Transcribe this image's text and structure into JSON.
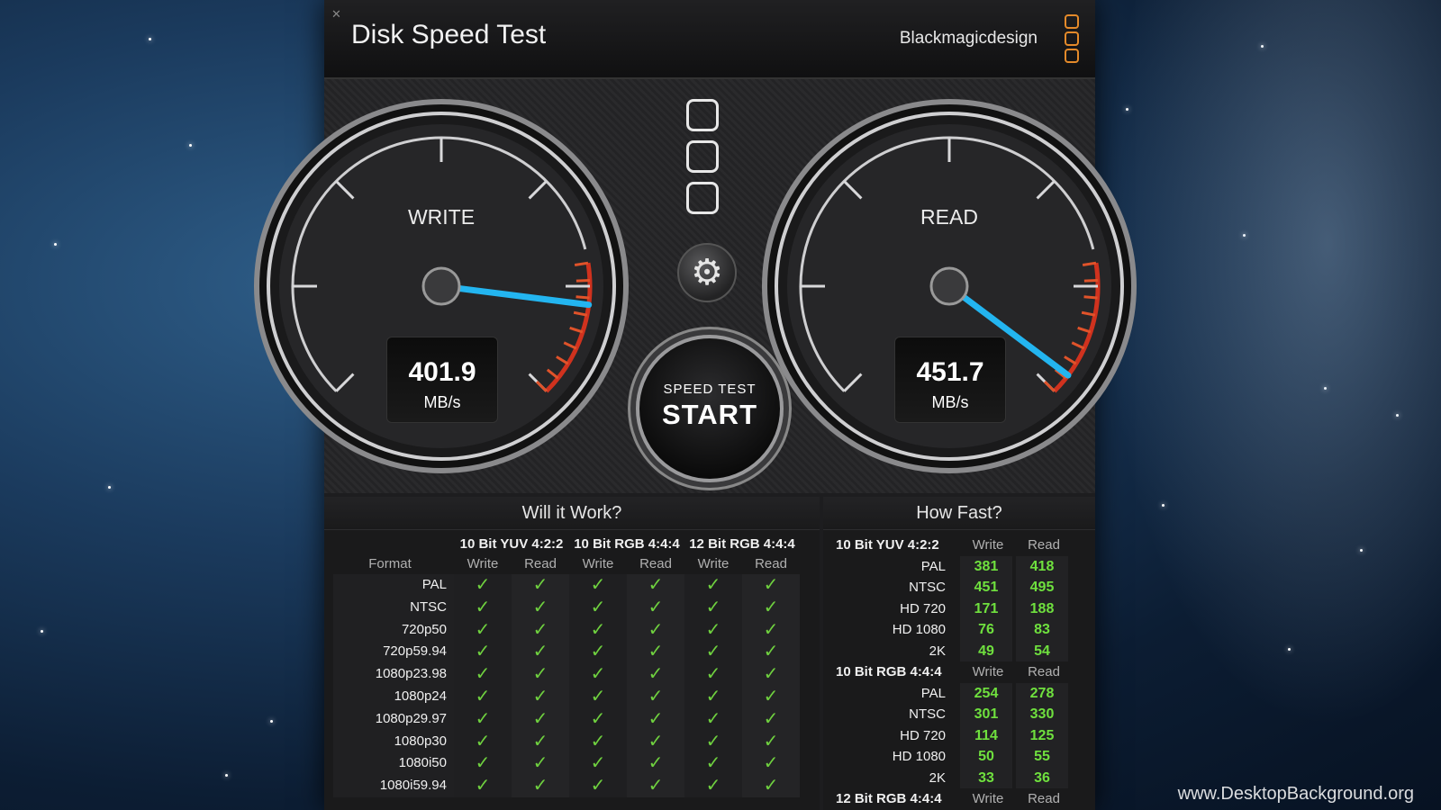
{
  "window": {
    "title": "Disk Speed Test",
    "brand": "Blackmagicdesign",
    "accent_color": "#e48a2a"
  },
  "gauges": {
    "write": {
      "label": "WRITE",
      "value": "401.9",
      "unit": "MB/s",
      "needle_fraction": 0.86
    },
    "read": {
      "label": "READ",
      "value": "451.7",
      "unit": "MB/s",
      "needle_fraction": 0.97
    },
    "needle_color": "#23b5f0"
  },
  "controls": {
    "settings_icon": "gear-icon",
    "start_small": "SPEED TEST",
    "start_big": "START"
  },
  "will_it_work": {
    "title": "Will it Work?",
    "format_header": "Format",
    "groups": [
      "10 Bit YUV 4:2:2",
      "10 Bit RGB 4:4:4",
      "12 Bit RGB 4:4:4"
    ],
    "subcols": [
      "Write",
      "Read"
    ],
    "rows": [
      {
        "format": "PAL",
        "checks": [
          true,
          true,
          true,
          true,
          true,
          true
        ]
      },
      {
        "format": "NTSC",
        "checks": [
          true,
          true,
          true,
          true,
          true,
          true
        ]
      },
      {
        "format": "720p50",
        "checks": [
          true,
          true,
          true,
          true,
          true,
          true
        ]
      },
      {
        "format": "720p59.94",
        "checks": [
          true,
          true,
          true,
          true,
          true,
          true
        ]
      },
      {
        "format": "1080p23.98",
        "checks": [
          true,
          true,
          true,
          true,
          true,
          true
        ]
      },
      {
        "format": "1080p24",
        "checks": [
          true,
          true,
          true,
          true,
          true,
          true
        ]
      },
      {
        "format": "1080p29.97",
        "checks": [
          true,
          true,
          true,
          true,
          true,
          true
        ]
      },
      {
        "format": "1080p30",
        "checks": [
          true,
          true,
          true,
          true,
          true,
          true
        ]
      },
      {
        "format": "1080i50",
        "checks": [
          true,
          true,
          true,
          true,
          true,
          true
        ]
      },
      {
        "format": "1080i59.94",
        "checks": [
          true,
          true,
          true,
          true,
          true,
          true
        ]
      }
    ],
    "check_glyph": "✓"
  },
  "how_fast": {
    "title": "How Fast?",
    "write_label": "Write",
    "read_label": "Read",
    "groups": [
      {
        "name": "10 Bit YUV 4:2:2",
        "rows": [
          {
            "format": "PAL",
            "write": "381",
            "read": "418"
          },
          {
            "format": "NTSC",
            "write": "451",
            "read": "495"
          },
          {
            "format": "HD 720",
            "write": "171",
            "read": "188"
          },
          {
            "format": "HD 1080",
            "write": "76",
            "read": "83"
          },
          {
            "format": "2K",
            "write": "49",
            "read": "54"
          }
        ]
      },
      {
        "name": "10 Bit RGB 4:4:4",
        "rows": [
          {
            "format": "PAL",
            "write": "254",
            "read": "278"
          },
          {
            "format": "NTSC",
            "write": "301",
            "read": "330"
          },
          {
            "format": "HD 720",
            "write": "114",
            "read": "125"
          },
          {
            "format": "HD 1080",
            "write": "50",
            "read": "55"
          },
          {
            "format": "2K",
            "write": "33",
            "read": "36"
          }
        ]
      },
      {
        "name": "12 Bit RGB 4:4:4",
        "rows": []
      }
    ]
  },
  "watermark": "www.DesktopBackground.org"
}
